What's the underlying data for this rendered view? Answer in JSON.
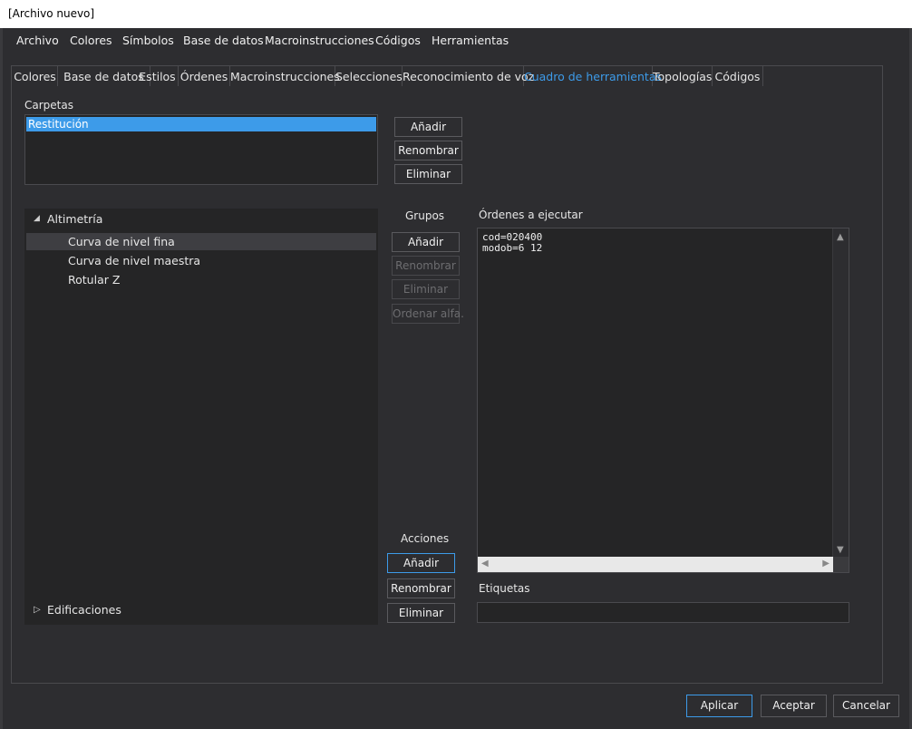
{
  "window": {
    "title": "[Archivo nuevo]"
  },
  "menubar": {
    "items": [
      "Archivo",
      "Colores",
      "Símbolos",
      "Base de datos",
      "Macroinstrucciones",
      "Códigos",
      "Herramientas"
    ]
  },
  "tabs": {
    "items": [
      "Colores",
      "Base de datos",
      "Estilos",
      "Órdenes",
      "Macroinstrucciones",
      "Selecciones",
      "Reconocimiento de voz",
      "Cuadro de herramientas",
      "Topologías",
      "Códigos"
    ],
    "active": "Cuadro de herramientas"
  },
  "carpetas": {
    "label": "Carpetas",
    "items": [
      "Restitución"
    ],
    "selected": "Restitución",
    "buttons": {
      "add": "Añadir",
      "rename": "Renombrar",
      "delete": "Eliminar"
    }
  },
  "tree": {
    "groups": [
      {
        "label": "Altimetría",
        "expanded": true,
        "children": [
          "Curva de nivel fina",
          "Curva de nivel maestra",
          "Rotular Z"
        ]
      },
      {
        "label": "Edificaciones",
        "expanded": false,
        "children": []
      }
    ],
    "hovered": "Curva de nivel fina"
  },
  "grupos": {
    "label": "Grupos",
    "buttons": {
      "add": "Añadir",
      "rename": "Renombrar",
      "delete": "Eliminar",
      "sort": "Ordenar alfa."
    },
    "disabled": [
      "rename",
      "delete",
      "sort"
    ]
  },
  "acciones": {
    "label": "Acciones",
    "buttons": {
      "add": "Añadir",
      "rename": "Renombrar",
      "delete": "Eliminar"
    }
  },
  "ordenes": {
    "label": "Órdenes a ejecutar",
    "text": "cod=020400\nmodob=6 12"
  },
  "etiquetas": {
    "label": "Etiquetas",
    "value": "",
    "placeholder": ""
  },
  "footer": {
    "apply": "Aplicar",
    "accept": "Aceptar",
    "cancel": "Cancelar"
  },
  "colors": {
    "accent": "#3d9be9",
    "background": "#2d2d30",
    "input": "#252526"
  }
}
